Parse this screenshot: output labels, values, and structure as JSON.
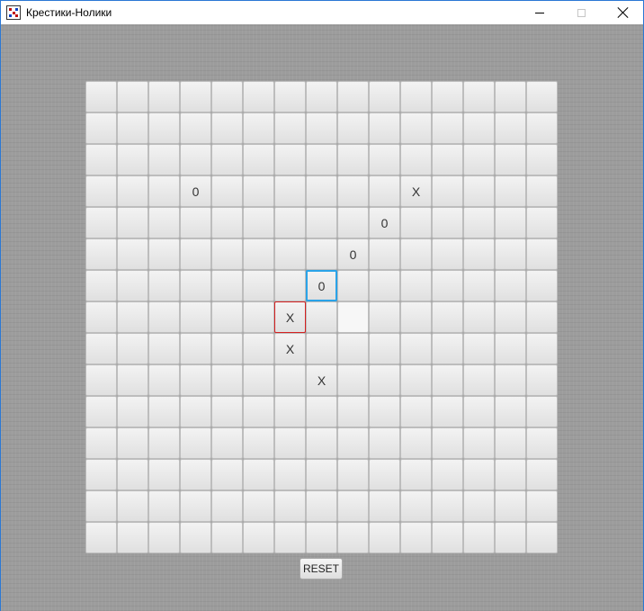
{
  "window": {
    "title": "Крестики-Нолики"
  },
  "board": {
    "rows": 15,
    "cols": 15,
    "marks": [
      {
        "row": 3,
        "col": 3,
        "symbol": "0"
      },
      {
        "row": 3,
        "col": 10,
        "symbol": "X"
      },
      {
        "row": 4,
        "col": 9,
        "symbol": "0"
      },
      {
        "row": 5,
        "col": 8,
        "symbol": "0"
      },
      {
        "row": 6,
        "col": 7,
        "symbol": "0",
        "state": "focused"
      },
      {
        "row": 7,
        "col": 6,
        "symbol": "X",
        "state": "last-move"
      },
      {
        "row": 8,
        "col": 6,
        "symbol": "X"
      },
      {
        "row": 9,
        "col": 7,
        "symbol": "X"
      }
    ],
    "hover_cell": {
      "row": 7,
      "col": 8
    }
  },
  "controls": {
    "reset_label": "RESET"
  }
}
